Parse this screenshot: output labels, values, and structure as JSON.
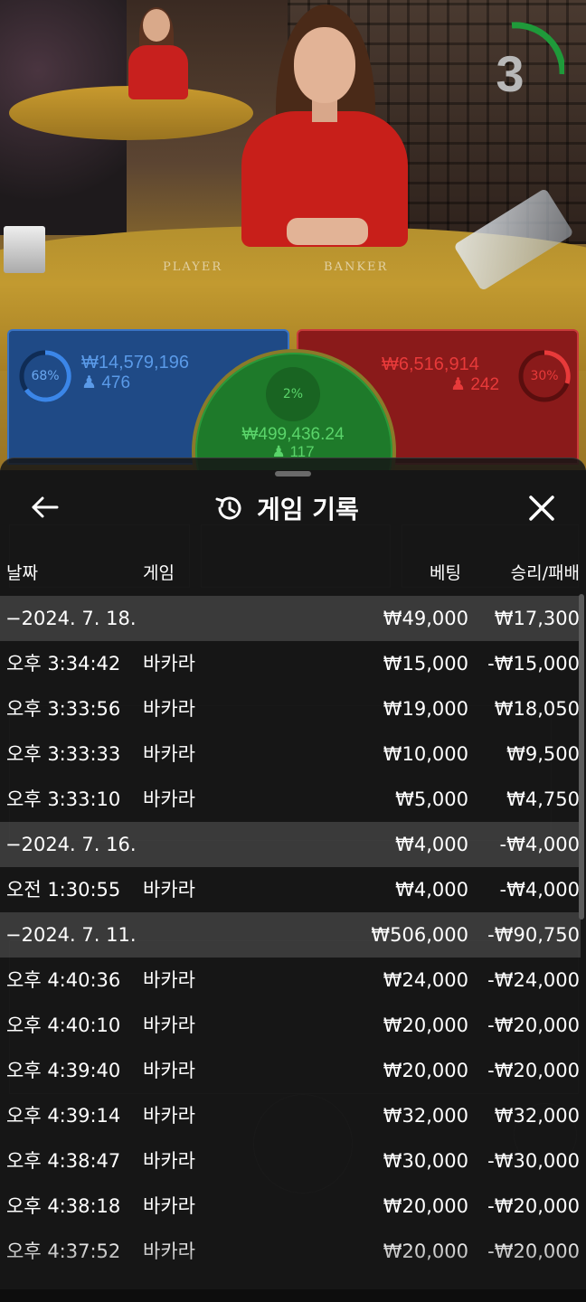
{
  "video": {
    "countdown": "3",
    "table_labels": {
      "player": "PLAYER",
      "banker": "BANKER"
    }
  },
  "board": {
    "player": {
      "pct": "68%",
      "amount": "₩14,579,196",
      "count": "476",
      "color": "#1f4a86"
    },
    "banker": {
      "pct": "30%",
      "amount": "₩6,516,914",
      "count": "242",
      "color": "#8a1a1a"
    },
    "tie": {
      "pct": "2%",
      "amount": "₩499,436.24",
      "count": "117",
      "color": "#1e7a2a"
    }
  },
  "sheet": {
    "title": "게임 기록",
    "back_icon": "arrow-left-icon",
    "history_icon": "history-clock-icon",
    "close_icon": "close-x-icon",
    "columns": {
      "date": "날짜",
      "game": "게임",
      "bet": "베팅",
      "result": "승리/패배"
    },
    "rows": [
      {
        "type": "date",
        "label": "−2024. 7. 18.",
        "bet": "₩49,000",
        "result": "₩17,300"
      },
      {
        "type": "item",
        "time": "오후 3:34:42",
        "game": "바카라",
        "bet": "₩15,000",
        "result": "-₩15,000"
      },
      {
        "type": "item",
        "time": "오후 3:33:56",
        "game": "바카라",
        "bet": "₩19,000",
        "result": "₩18,050"
      },
      {
        "type": "item",
        "time": "오후 3:33:33",
        "game": "바카라",
        "bet": "₩10,000",
        "result": "₩9,500"
      },
      {
        "type": "item",
        "time": "오후 3:33:10",
        "game": "바카라",
        "bet": "₩5,000",
        "result": "₩4,750"
      },
      {
        "type": "date",
        "label": "−2024. 7. 16.",
        "bet": "₩4,000",
        "result": "-₩4,000"
      },
      {
        "type": "item",
        "time": "오전 1:30:55",
        "game": "바카라",
        "bet": "₩4,000",
        "result": "-₩4,000"
      },
      {
        "type": "date",
        "label": "−2024. 7. 11.",
        "bet": "₩506,000",
        "result": "-₩90,750"
      },
      {
        "type": "item",
        "time": "오후 4:40:36",
        "game": "바카라",
        "bet": "₩24,000",
        "result": "-₩24,000"
      },
      {
        "type": "item",
        "time": "오후 4:40:10",
        "game": "바카라",
        "bet": "₩20,000",
        "result": "-₩20,000"
      },
      {
        "type": "item",
        "time": "오후 4:39:40",
        "game": "바카라",
        "bet": "₩20,000",
        "result": "-₩20,000"
      },
      {
        "type": "item",
        "time": "오후 4:39:14",
        "game": "바카라",
        "bet": "₩32,000",
        "result": "₩32,000"
      },
      {
        "type": "item",
        "time": "오후 4:38:47",
        "game": "바카라",
        "bet": "₩30,000",
        "result": "-₩30,000"
      },
      {
        "type": "item",
        "time": "오후 4:38:18",
        "game": "바카라",
        "bet": "₩20,000",
        "result": "-₩20,000"
      },
      {
        "type": "item",
        "time": "오후 4:37:52",
        "game": "바카라",
        "bet": "₩20,000",
        "result": "-₩20,000"
      }
    ]
  }
}
